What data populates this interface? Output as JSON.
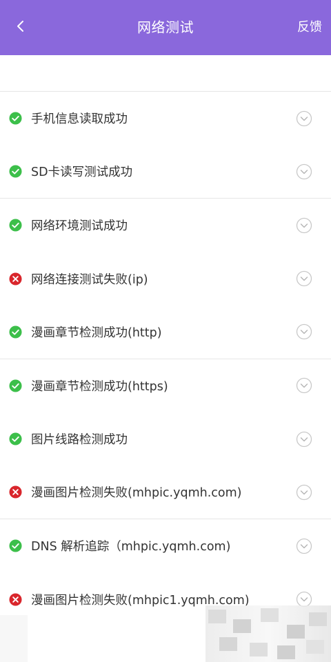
{
  "header": {
    "title": "网络测试",
    "feedback_label": "反馈",
    "background_color": "#8a68dc"
  },
  "status_colors": {
    "success": "#3cbf4a",
    "fail": "#d9262c"
  },
  "items": [
    {
      "label": "手机信息读取成功",
      "status": "success",
      "icon": "check-circle-icon"
    },
    {
      "label": "SD卡读写测试成功",
      "status": "success",
      "icon": "check-circle-icon"
    },
    {
      "label": "网络环境测试成功",
      "status": "success",
      "icon": "check-circle-icon"
    },
    {
      "label": "网络连接测试失败(ip)",
      "status": "fail",
      "icon": "x-circle-icon"
    },
    {
      "label": "漫画章节检测成功(http)",
      "status": "success",
      "icon": "check-circle-icon"
    },
    {
      "label": "漫画章节检测成功(https)",
      "status": "success",
      "icon": "check-circle-icon"
    },
    {
      "label": "图片线路检测成功",
      "status": "success",
      "icon": "check-circle-icon"
    },
    {
      "label": "漫画图片检测失败(mhpic.yqmh.com)",
      "status": "fail",
      "icon": "x-circle-icon"
    },
    {
      "label": "DNS 解析追踪（mhpic.yqmh.com)",
      "status": "success",
      "icon": "check-circle-icon"
    },
    {
      "label": "漫画图片检测失败(mhpic1.yqmh.com)",
      "status": "fail",
      "icon": "x-circle-icon"
    }
  ]
}
